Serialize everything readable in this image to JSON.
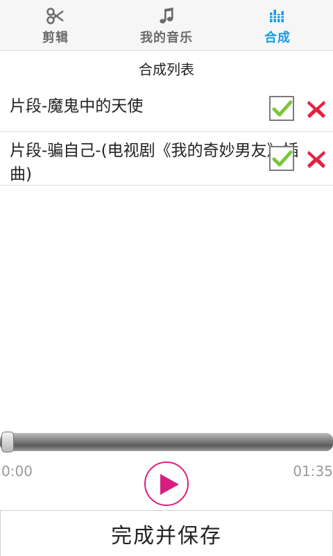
{
  "tabs": [
    {
      "label": "剪辑",
      "icon": "scissors-icon",
      "active": false
    },
    {
      "label": "我的音乐",
      "icon": "music-note-icon",
      "active": false
    },
    {
      "label": "合成",
      "icon": "equalizer-icon",
      "active": true
    }
  ],
  "list": {
    "title": "合成列表",
    "items": [
      {
        "name": "片段-魔鬼中的天使",
        "checked": true
      },
      {
        "name": "片段-骗自己-(电视剧《我的奇妙男友》插曲)",
        "checked": true
      }
    ]
  },
  "player": {
    "current_time": "0:00",
    "total_time": "01:35",
    "progress": 0,
    "play_icon": "play-icon"
  },
  "save_button": {
    "label": "完成并保存"
  },
  "colors": {
    "accent": "#1a9be6",
    "inactive_tab": "#6a6a6a",
    "play_pink": "#d61f80",
    "check_green": "#7cc63a",
    "delete_red": "#e52044"
  }
}
